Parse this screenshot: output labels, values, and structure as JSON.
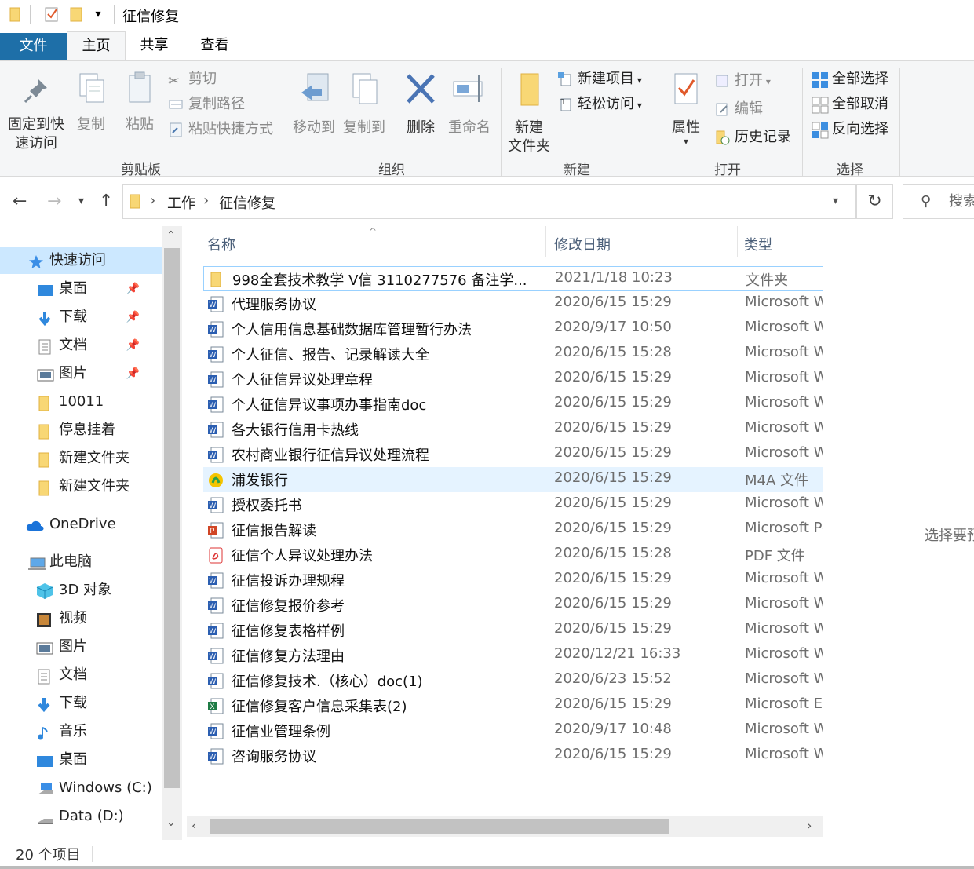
{
  "window": {
    "title": "征信修复"
  },
  "tabs": {
    "file": "文件",
    "home": "主页",
    "share": "共享",
    "view": "查看"
  },
  "ribbon": {
    "clipboard": {
      "label": "剪贴板",
      "pin": "固定到快\n速访问",
      "pin_l1": "固定到快",
      "pin_l2": "速访问",
      "copy": "复制",
      "paste": "粘贴",
      "cut": "剪切",
      "copy_path": "复制路径",
      "paste_shortcut": "粘贴快捷方式"
    },
    "organize": {
      "label": "组织",
      "move_to": "移动到",
      "copy_to": "复制到",
      "delete": "删除",
      "rename": "重命名"
    },
    "new": {
      "label": "新建",
      "new_folder_l1": "新建",
      "new_folder_l2": "文件夹",
      "new_item": "新建项目",
      "easy_access": "轻松访问"
    },
    "open": {
      "label": "打开",
      "properties": "属性",
      "open": "打开",
      "edit": "编辑",
      "history": "历史记录"
    },
    "select": {
      "label": "选择",
      "select_all": "全部选择",
      "select_none": "全部取消",
      "invert": "反向选择"
    }
  },
  "address": {
    "crumbs": [
      "工作",
      "征信修复"
    ],
    "search_placeholder": "搜索"
  },
  "nav": {
    "quick_access": "快速访问",
    "quick_items": [
      {
        "label": "桌面",
        "pinned": true
      },
      {
        "label": "下载",
        "pinned": true
      },
      {
        "label": "文档",
        "pinned": true
      },
      {
        "label": "图片",
        "pinned": true
      },
      {
        "label": "10011",
        "pinned": false
      },
      {
        "label": "停息挂着",
        "pinned": false
      },
      {
        "label": "新建文件夹",
        "pinned": false
      },
      {
        "label": "新建文件夹",
        "pinned": false
      }
    ],
    "onedrive": "OneDrive",
    "this_pc": "此电脑",
    "pc_items": [
      "3D 对象",
      "视频",
      "图片",
      "文档",
      "下载",
      "音乐",
      "桌面",
      "Windows (C:)",
      "Data (D:)"
    ]
  },
  "columns": {
    "name": "名称",
    "date": "修改日期",
    "type": "类型"
  },
  "files": [
    {
      "name": "998全套技术教学  V信 3110277576   备注学...",
      "date": "2021/1/18 10:23",
      "type": "文件夹",
      "icon": "folder"
    },
    {
      "name": "代理服务协议",
      "date": "2020/6/15 15:29",
      "type": "Microsoft W",
      "icon": "word"
    },
    {
      "name": "个人信用信息基础数据库管理暂行办法",
      "date": "2020/9/17 10:50",
      "type": "Microsoft W",
      "icon": "word"
    },
    {
      "name": "个人征信、报告、记录解读大全",
      "date": "2020/6/15 15:28",
      "type": "Microsoft W",
      "icon": "word"
    },
    {
      "name": "个人征信异议处理章程",
      "date": "2020/6/15 15:29",
      "type": "Microsoft W",
      "icon": "word"
    },
    {
      "name": "个人征信异议事项办事指南doc",
      "date": "2020/6/15 15:29",
      "type": "Microsoft W",
      "icon": "word"
    },
    {
      "name": "各大银行信用卡热线",
      "date": "2020/6/15 15:29",
      "type": "Microsoft W",
      "icon": "word"
    },
    {
      "name": "农村商业银行征信异议处理流程",
      "date": "2020/6/15 15:29",
      "type": "Microsoft W",
      "icon": "word"
    },
    {
      "name": "浦发银行",
      "date": "2020/6/15 15:29",
      "type": "M4A 文件",
      "icon": "m4a"
    },
    {
      "name": "授权委托书",
      "date": "2020/6/15 15:29",
      "type": "Microsoft W",
      "icon": "word"
    },
    {
      "name": "征信报告解读",
      "date": "2020/6/15 15:29",
      "type": "Microsoft Po",
      "icon": "ppt"
    },
    {
      "name": "征信个人异议处理办法",
      "date": "2020/6/15 15:28",
      "type": "PDF 文件",
      "icon": "pdf"
    },
    {
      "name": "征信投诉办理规程",
      "date": "2020/6/15 15:29",
      "type": "Microsoft W",
      "icon": "word"
    },
    {
      "name": "征信修复报价参考",
      "date": "2020/6/15 15:29",
      "type": "Microsoft W",
      "icon": "word"
    },
    {
      "name": "征信修复表格样例",
      "date": "2020/6/15 15:29",
      "type": "Microsoft W",
      "icon": "word"
    },
    {
      "name": "征信修复方法理由",
      "date": "2020/12/21 16:33",
      "type": "Microsoft W",
      "icon": "word"
    },
    {
      "name": "征信修复技术.（核心）doc(1)",
      "date": "2020/6/23 15:52",
      "type": "Microsoft W",
      "icon": "word"
    },
    {
      "name": "征信修复客户信息采集表(2)",
      "date": "2020/6/15 15:29",
      "type": "Microsoft Ex",
      "icon": "excel"
    },
    {
      "name": "征信业管理条例",
      "date": "2020/9/17 10:48",
      "type": "Microsoft W",
      "icon": "word"
    },
    {
      "name": "咨询服务协议",
      "date": "2020/6/15 15:29",
      "type": "Microsoft W",
      "icon": "word"
    }
  ],
  "preview": {
    "text": "选择要预"
  },
  "status": {
    "count": "20 个项目"
  },
  "colors": {
    "accent": "#1e6fa8",
    "selected_row": "#e5f3ff",
    "nav_selected": "#cce8ff"
  }
}
